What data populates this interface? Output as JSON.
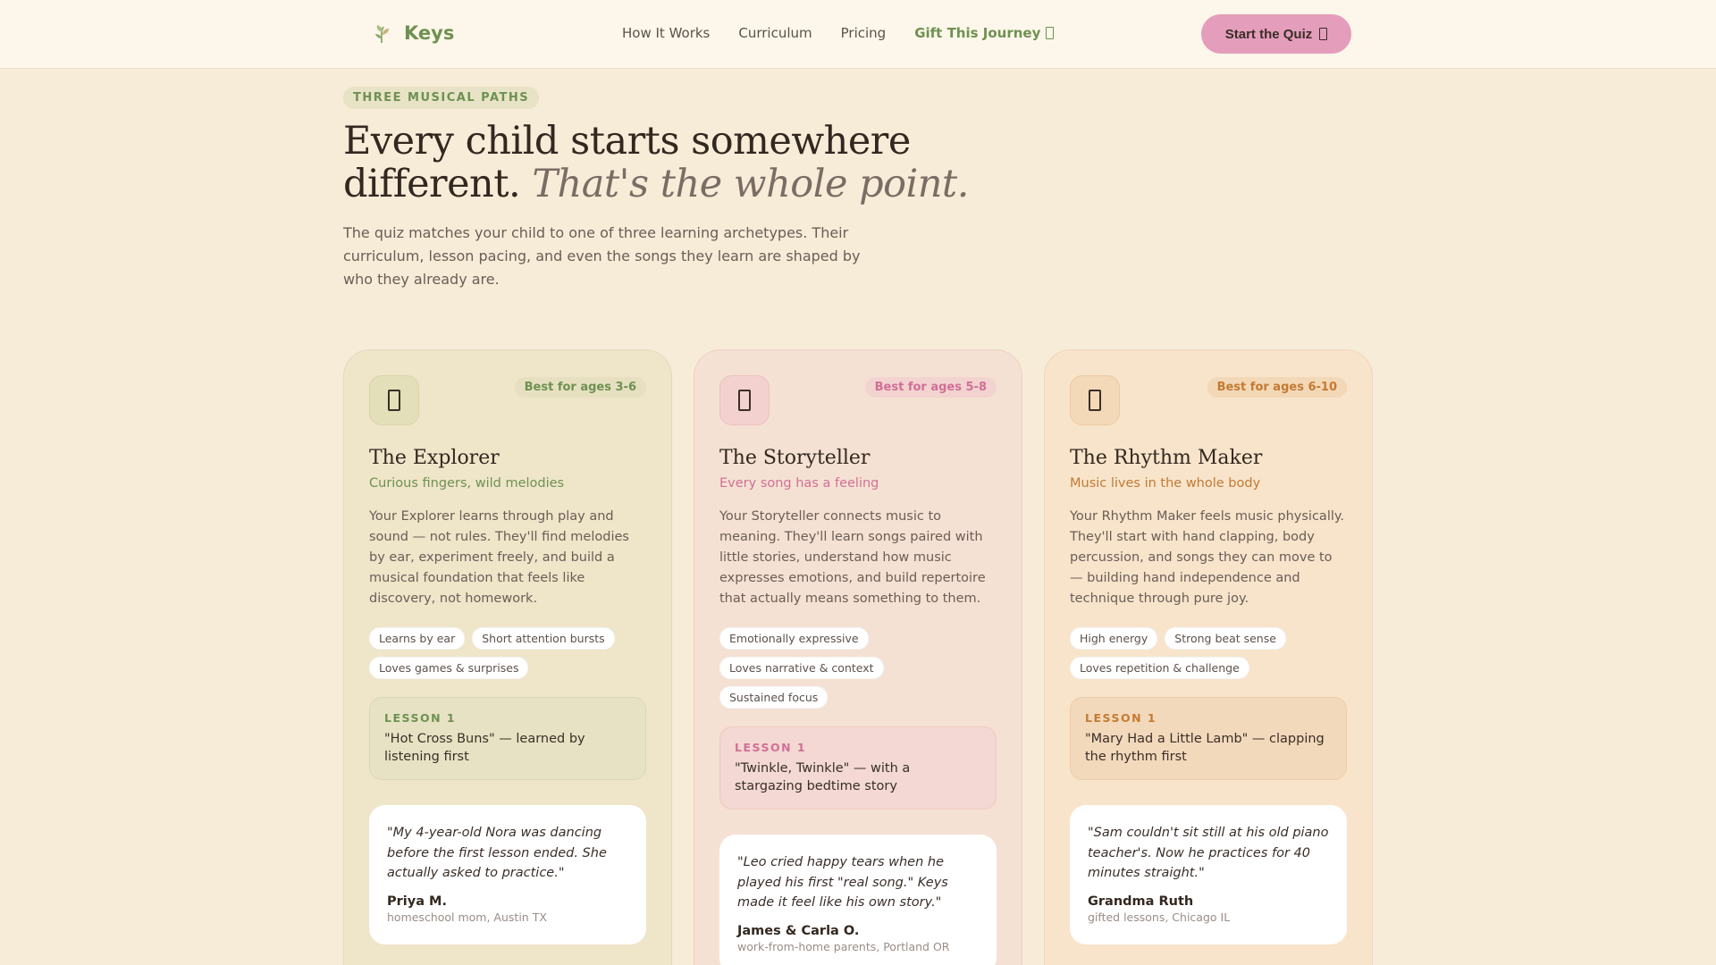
{
  "nav": {
    "brand": "Keys",
    "links": [
      "How It Works",
      "Curriculum",
      "Pricing"
    ],
    "gift": "Gift This Journey",
    "cta": "Start the Quiz"
  },
  "hero": {
    "eyebrow": "THREE MUSICAL PATHS",
    "headline_main": "Every child starts somewhere different.",
    "headline_em": "That's the whole point.",
    "subhead": "The quiz matches your child to one of three learning archetypes. Their curriculum, lesson pacing, and even the songs they learn are shaped by who they already are."
  },
  "cards": [
    {
      "age": "Best for ages 3-6",
      "title": "The Explorer",
      "tagline": "Curious fingers, wild melodies",
      "body": "Your Explorer learns through play and sound — not rules. They'll find melodies by ear, experiment freely, and build a musical foundation that feels like discovery, not homework.",
      "tags": [
        "Learns by ear",
        "Short attention bursts",
        "Loves games & surprises"
      ],
      "lesson_label": "LESSON 1",
      "lesson_text": "\"Hot Cross Buns\" — learned by listening first",
      "quote": "\"My 4-year-old Nora was dancing before the first lesson ended. She actually asked to practice.\"",
      "author": "Priya M.",
      "author_meta": "homeschool mom, Austin TX"
    },
    {
      "age": "Best for ages 5-8",
      "title": "The Storyteller",
      "tagline": "Every song has a feeling",
      "body": "Your Storyteller connects music to meaning. They'll learn songs paired with little stories, understand how music expresses emotions, and build repertoire that actually means something to them.",
      "tags": [
        "Emotionally expressive",
        "Loves narrative & context",
        "Sustained focus"
      ],
      "lesson_label": "LESSON 1",
      "lesson_text": "\"Twinkle, Twinkle\" — with a stargazing bedtime story",
      "quote": "\"Leo cried happy tears when he played his first \"real song.\" Keys made it feel like his own story.\"",
      "author": "James & Carla O.",
      "author_meta": "work-from-home parents, Portland OR"
    },
    {
      "age": "Best for ages 6-10",
      "title": "The Rhythm Maker",
      "tagline": "Music lives in the whole body",
      "body": "Your Rhythm Maker feels music physically. They'll start with hand clapping, body percussion, and songs they can move to — building hand independence and technique through pure joy.",
      "tags": [
        "High energy",
        "Strong beat sense",
        "Loves repetition & challenge"
      ],
      "lesson_label": "LESSON 1",
      "lesson_text": "\"Mary Had a Little Lamb\" — clapping the rhythm first",
      "quote": "\"Sam couldn't sit still at his old piano teacher's. Now he practices for 40 minutes straight.\"",
      "author": "Grandma Ruth",
      "author_meta": "gifted lessons, Chicago IL"
    }
  ]
}
